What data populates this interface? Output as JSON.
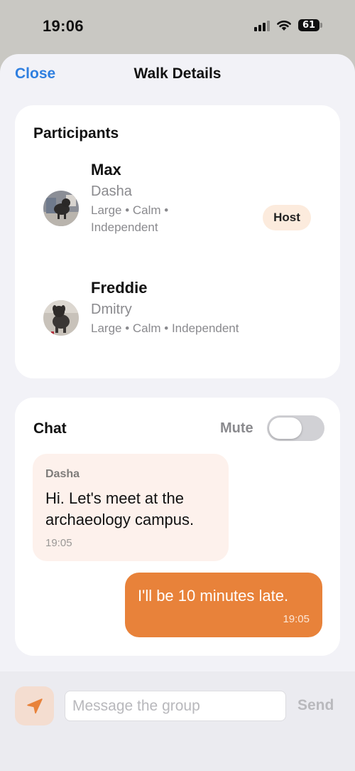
{
  "status_bar": {
    "time": "19:06",
    "battery": "61"
  },
  "nav": {
    "close_label": "Close",
    "title": "Walk Details"
  },
  "participants": {
    "title": "Participants",
    "items": [
      {
        "name": "Max",
        "owner": "Dasha",
        "traits": "Large • Calm • Independent",
        "badge": "Host"
      },
      {
        "name": "Freddie",
        "owner": "Dmitry",
        "traits": "Large • Calm • Independent"
      }
    ]
  },
  "chat": {
    "title": "Chat",
    "mute_label": "Mute",
    "mute_on": false,
    "messages": [
      {
        "sender": "Dasha",
        "text": "Hi. Let's meet at the archaeology campus.",
        "time": "19:05",
        "outgoing": false
      },
      {
        "text": "I'll be 10 minutes late.",
        "time": "19:05",
        "outgoing": true
      }
    ]
  },
  "composer": {
    "placeholder": "Message the group",
    "value": "",
    "send_label": "Send"
  },
  "colors": {
    "accent_blue": "#2f7fe0",
    "accent_orange": "#e8823a",
    "badge_bg": "#fcebdd"
  },
  "icons": {
    "location": "location-arrow-icon",
    "wifi": "wifi-icon",
    "signal": "signal-icon",
    "battery": "battery-icon"
  }
}
